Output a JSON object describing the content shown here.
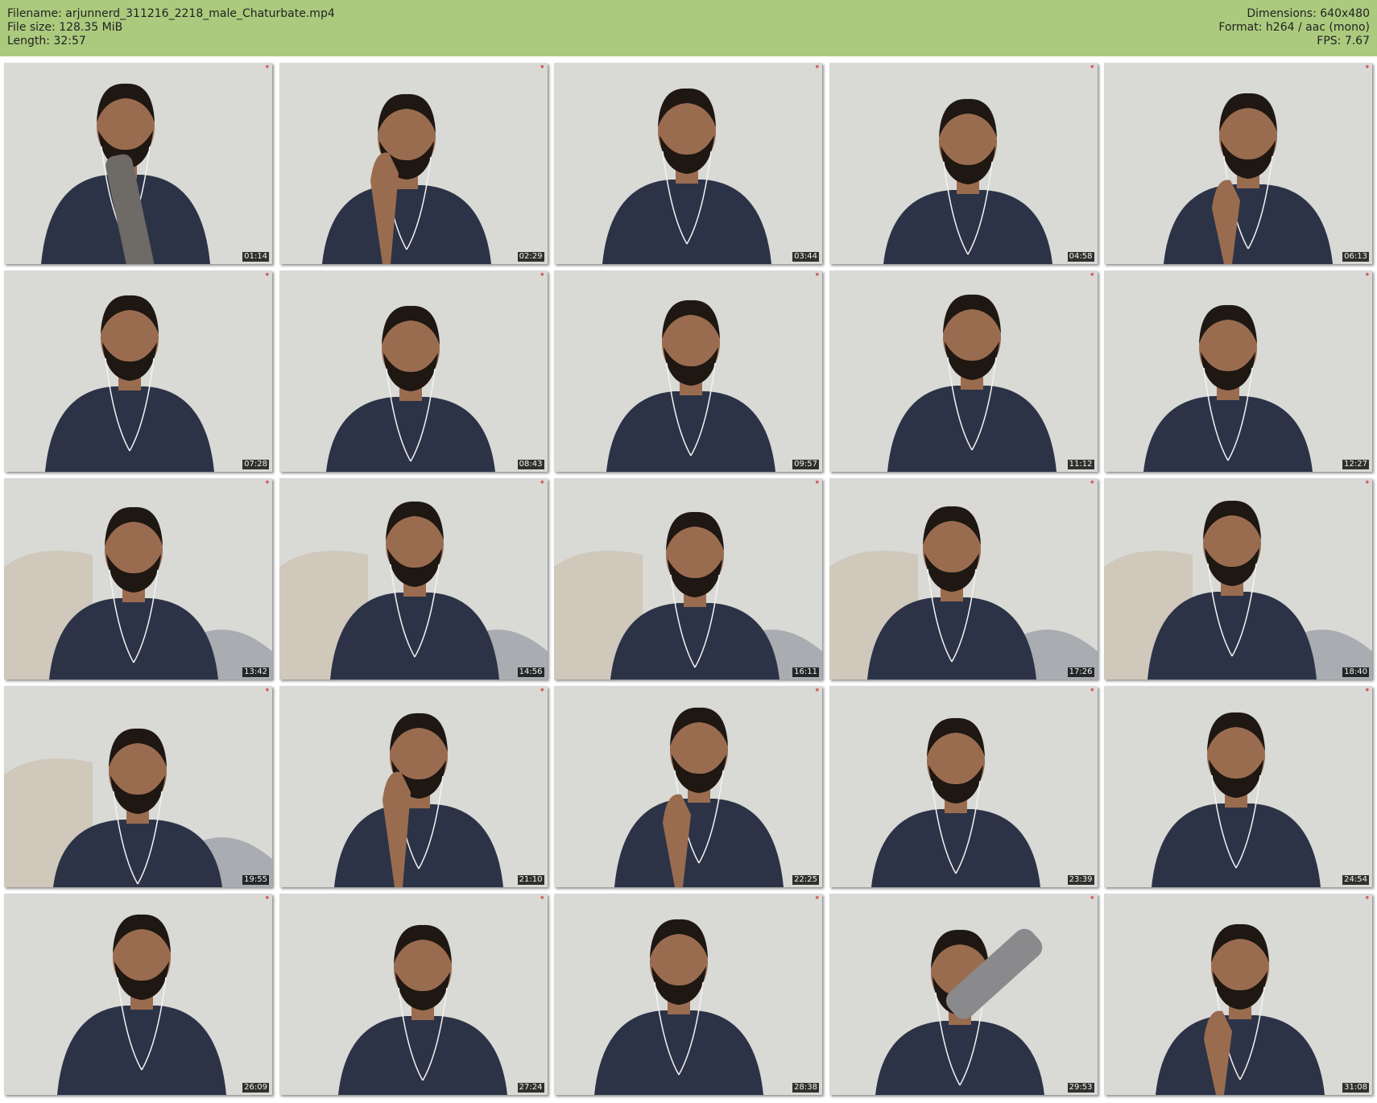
{
  "header": {
    "filename": "Filename: arjunnerd_311216_2218_male_Chaturbate.mp4",
    "filesize": "File size: 128.35 MiB",
    "length": "Length: 32:57",
    "dimensions": "Dimensions: 640x480",
    "format": "Format: h264 / aac (mono)",
    "fps": "FPS: 7.67"
  },
  "colors": {
    "header_bg": "#acca7e",
    "wall": "#d9d9d6",
    "shirt": "#2c3347",
    "skin": "#9a6c4f",
    "hair": "#1e1712"
  },
  "thumbnails": [
    {
      "timestamp": "01:14",
      "variant": "bottle-low"
    },
    {
      "timestamp": "02:29",
      "variant": "hand-face"
    },
    {
      "timestamp": "03:44",
      "variant": "plain"
    },
    {
      "timestamp": "04:58",
      "variant": "plain"
    },
    {
      "timestamp": "06:13",
      "variant": "hand-chin"
    },
    {
      "timestamp": "07:28",
      "variant": "plain"
    },
    {
      "timestamp": "08:43",
      "variant": "plain"
    },
    {
      "timestamp": "09:57",
      "variant": "plain"
    },
    {
      "timestamp": "11:12",
      "variant": "plain"
    },
    {
      "timestamp": "12:27",
      "variant": "plain"
    },
    {
      "timestamp": "13:42",
      "variant": "couch"
    },
    {
      "timestamp": "14:56",
      "variant": "couch"
    },
    {
      "timestamp": "16:11",
      "variant": "couch"
    },
    {
      "timestamp": "17:26",
      "variant": "couch"
    },
    {
      "timestamp": "18:40",
      "variant": "couch"
    },
    {
      "timestamp": "19:55",
      "variant": "couch-low"
    },
    {
      "timestamp": "21:10",
      "variant": "hand-face"
    },
    {
      "timestamp": "22:25",
      "variant": "hand-chin"
    },
    {
      "timestamp": "23:39",
      "variant": "plain"
    },
    {
      "timestamp": "24:54",
      "variant": "plain"
    },
    {
      "timestamp": "26:09",
      "variant": "plain"
    },
    {
      "timestamp": "27:24",
      "variant": "plain"
    },
    {
      "timestamp": "28:38",
      "variant": "plain"
    },
    {
      "timestamp": "29:53",
      "variant": "bottle-high"
    },
    {
      "timestamp": "31:08",
      "variant": "hand-chin"
    }
  ]
}
